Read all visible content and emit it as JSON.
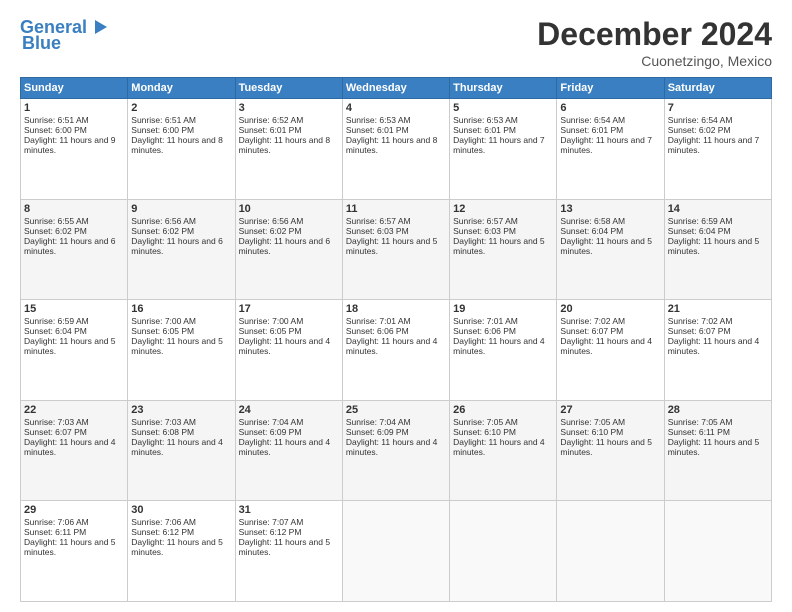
{
  "logo": {
    "line1": "General",
    "line2": "Blue"
  },
  "header": {
    "month": "December 2024",
    "location": "Cuonetzingo, Mexico"
  },
  "weekdays": [
    "Sunday",
    "Monday",
    "Tuesday",
    "Wednesday",
    "Thursday",
    "Friday",
    "Saturday"
  ],
  "weeks": [
    [
      {
        "day": "1",
        "sunrise": "Sunrise: 6:51 AM",
        "sunset": "Sunset: 6:00 PM",
        "daylight": "Daylight: 11 hours and 9 minutes."
      },
      {
        "day": "2",
        "sunrise": "Sunrise: 6:51 AM",
        "sunset": "Sunset: 6:00 PM",
        "daylight": "Daylight: 11 hours and 8 minutes."
      },
      {
        "day": "3",
        "sunrise": "Sunrise: 6:52 AM",
        "sunset": "Sunset: 6:01 PM",
        "daylight": "Daylight: 11 hours and 8 minutes."
      },
      {
        "day": "4",
        "sunrise": "Sunrise: 6:53 AM",
        "sunset": "Sunset: 6:01 PM",
        "daylight": "Daylight: 11 hours and 8 minutes."
      },
      {
        "day": "5",
        "sunrise": "Sunrise: 6:53 AM",
        "sunset": "Sunset: 6:01 PM",
        "daylight": "Daylight: 11 hours and 7 minutes."
      },
      {
        "day": "6",
        "sunrise": "Sunrise: 6:54 AM",
        "sunset": "Sunset: 6:01 PM",
        "daylight": "Daylight: 11 hours and 7 minutes."
      },
      {
        "day": "7",
        "sunrise": "Sunrise: 6:54 AM",
        "sunset": "Sunset: 6:02 PM",
        "daylight": "Daylight: 11 hours and 7 minutes."
      }
    ],
    [
      {
        "day": "8",
        "sunrise": "Sunrise: 6:55 AM",
        "sunset": "Sunset: 6:02 PM",
        "daylight": "Daylight: 11 hours and 6 minutes."
      },
      {
        "day": "9",
        "sunrise": "Sunrise: 6:56 AM",
        "sunset": "Sunset: 6:02 PM",
        "daylight": "Daylight: 11 hours and 6 minutes."
      },
      {
        "day": "10",
        "sunrise": "Sunrise: 6:56 AM",
        "sunset": "Sunset: 6:02 PM",
        "daylight": "Daylight: 11 hours and 6 minutes."
      },
      {
        "day": "11",
        "sunrise": "Sunrise: 6:57 AM",
        "sunset": "Sunset: 6:03 PM",
        "daylight": "Daylight: 11 hours and 5 minutes."
      },
      {
        "day": "12",
        "sunrise": "Sunrise: 6:57 AM",
        "sunset": "Sunset: 6:03 PM",
        "daylight": "Daylight: 11 hours and 5 minutes."
      },
      {
        "day": "13",
        "sunrise": "Sunrise: 6:58 AM",
        "sunset": "Sunset: 6:04 PM",
        "daylight": "Daylight: 11 hours and 5 minutes."
      },
      {
        "day": "14",
        "sunrise": "Sunrise: 6:59 AM",
        "sunset": "Sunset: 6:04 PM",
        "daylight": "Daylight: 11 hours and 5 minutes."
      }
    ],
    [
      {
        "day": "15",
        "sunrise": "Sunrise: 6:59 AM",
        "sunset": "Sunset: 6:04 PM",
        "daylight": "Daylight: 11 hours and 5 minutes."
      },
      {
        "day": "16",
        "sunrise": "Sunrise: 7:00 AM",
        "sunset": "Sunset: 6:05 PM",
        "daylight": "Daylight: 11 hours and 5 minutes."
      },
      {
        "day": "17",
        "sunrise": "Sunrise: 7:00 AM",
        "sunset": "Sunset: 6:05 PM",
        "daylight": "Daylight: 11 hours and 4 minutes."
      },
      {
        "day": "18",
        "sunrise": "Sunrise: 7:01 AM",
        "sunset": "Sunset: 6:06 PM",
        "daylight": "Daylight: 11 hours and 4 minutes."
      },
      {
        "day": "19",
        "sunrise": "Sunrise: 7:01 AM",
        "sunset": "Sunset: 6:06 PM",
        "daylight": "Daylight: 11 hours and 4 minutes."
      },
      {
        "day": "20",
        "sunrise": "Sunrise: 7:02 AM",
        "sunset": "Sunset: 6:07 PM",
        "daylight": "Daylight: 11 hours and 4 minutes."
      },
      {
        "day": "21",
        "sunrise": "Sunrise: 7:02 AM",
        "sunset": "Sunset: 6:07 PM",
        "daylight": "Daylight: 11 hours and 4 minutes."
      }
    ],
    [
      {
        "day": "22",
        "sunrise": "Sunrise: 7:03 AM",
        "sunset": "Sunset: 6:07 PM",
        "daylight": "Daylight: 11 hours and 4 minutes."
      },
      {
        "day": "23",
        "sunrise": "Sunrise: 7:03 AM",
        "sunset": "Sunset: 6:08 PM",
        "daylight": "Daylight: 11 hours and 4 minutes."
      },
      {
        "day": "24",
        "sunrise": "Sunrise: 7:04 AM",
        "sunset": "Sunset: 6:09 PM",
        "daylight": "Daylight: 11 hours and 4 minutes."
      },
      {
        "day": "25",
        "sunrise": "Sunrise: 7:04 AM",
        "sunset": "Sunset: 6:09 PM",
        "daylight": "Daylight: 11 hours and 4 minutes."
      },
      {
        "day": "26",
        "sunrise": "Sunrise: 7:05 AM",
        "sunset": "Sunset: 6:10 PM",
        "daylight": "Daylight: 11 hours and 4 minutes."
      },
      {
        "day": "27",
        "sunrise": "Sunrise: 7:05 AM",
        "sunset": "Sunset: 6:10 PM",
        "daylight": "Daylight: 11 hours and 5 minutes."
      },
      {
        "day": "28",
        "sunrise": "Sunrise: 7:05 AM",
        "sunset": "Sunset: 6:11 PM",
        "daylight": "Daylight: 11 hours and 5 minutes."
      }
    ],
    [
      {
        "day": "29",
        "sunrise": "Sunrise: 7:06 AM",
        "sunset": "Sunset: 6:11 PM",
        "daylight": "Daylight: 11 hours and 5 minutes."
      },
      {
        "day": "30",
        "sunrise": "Sunrise: 7:06 AM",
        "sunset": "Sunset: 6:12 PM",
        "daylight": "Daylight: 11 hours and 5 minutes."
      },
      {
        "day": "31",
        "sunrise": "Sunrise: 7:07 AM",
        "sunset": "Sunset: 6:12 PM",
        "daylight": "Daylight: 11 hours and 5 minutes."
      },
      null,
      null,
      null,
      null
    ]
  ]
}
